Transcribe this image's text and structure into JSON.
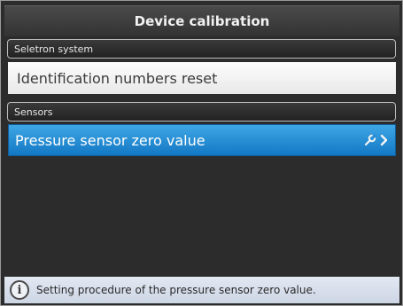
{
  "header": {
    "title": "Device calibration"
  },
  "sections": [
    {
      "label": "Seletron system",
      "items": [
        {
          "label": "Identification numbers reset"
        }
      ]
    },
    {
      "label": "Sensors",
      "items": [
        {
          "label": "Pressure sensor zero value",
          "selected": true,
          "icons": [
            "wrench-icon",
            "chevron-right-icon"
          ]
        }
      ]
    }
  ],
  "footer": {
    "icon": "info-icon",
    "icon_glyph": "i",
    "text": "Setting procedure of the pressure sensor zero value."
  },
  "colors": {
    "selected_bg": "#1e88d6",
    "background": "#2c2c2c"
  }
}
